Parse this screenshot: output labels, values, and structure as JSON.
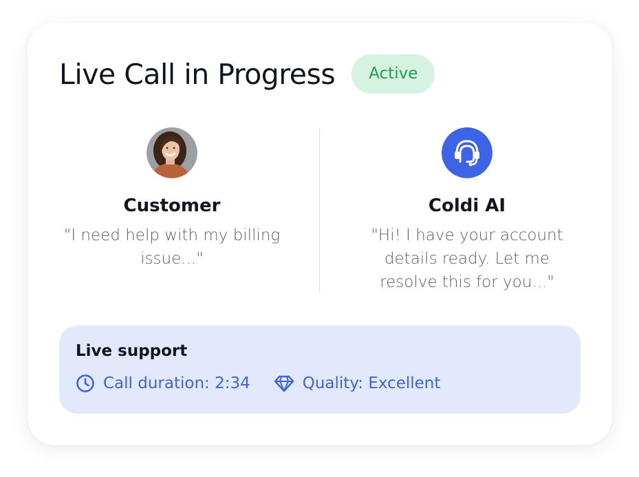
{
  "header": {
    "title": "Live Call in Progress",
    "status_badge": "Active"
  },
  "participants": [
    {
      "name": "Customer",
      "quote": "\"I need help with my billing issue...\"",
      "avatar_icon": "customer-photo-avatar"
    },
    {
      "name": "Coldi AI",
      "quote": "\"Hi! I have your account details ready. Let me resolve this for you...\"",
      "avatar_icon": "headset-agent-icon"
    }
  ],
  "support": {
    "title": "Live support",
    "duration_label": "Call duration: 2:34",
    "quality_label": "Quality: Excellent"
  },
  "colors": {
    "badge_bg": "#d6f3e1",
    "badge_text": "#1f9a55",
    "accent_blue": "#3f63d9",
    "ai_avatar": "#3d63e6",
    "support_bg": "#e3e9fc"
  }
}
